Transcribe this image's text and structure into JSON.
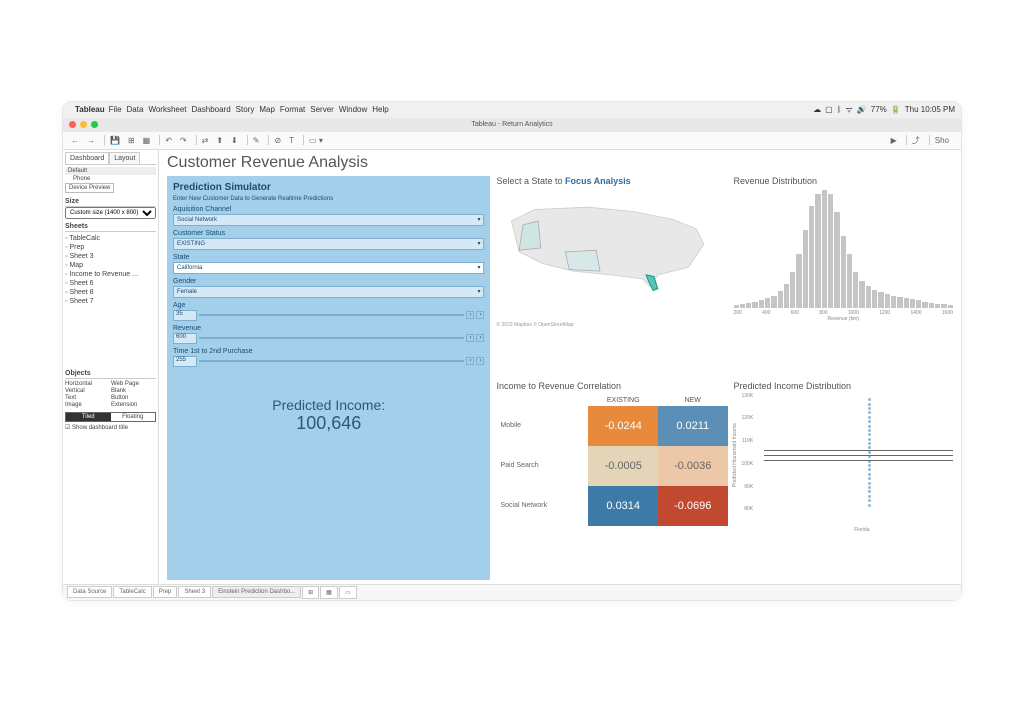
{
  "menubar": {
    "app": "Tableau",
    "menus": [
      "File",
      "Data",
      "Worksheet",
      "Dashboard",
      "Story",
      "Map",
      "Format",
      "Server",
      "Window",
      "Help"
    ],
    "battery": "77%",
    "time": "Thu 10:05 PM"
  },
  "titlebar": {
    "doc": "Tableau - Return Analytics"
  },
  "toolbar": {
    "show": "Sho"
  },
  "sidebar": {
    "tabs": {
      "dashboard": "Dashboard",
      "layout": "Layout"
    },
    "device": {
      "default": "Default",
      "phone": "Phone",
      "preview": "Device Preview"
    },
    "size": {
      "hdr": "Size",
      "value": "Custom size (1400 x 800)"
    },
    "sheets": {
      "hdr": "Sheets",
      "items": [
        "TableCalc",
        "Prep",
        "Sheet 3",
        "Map",
        "Income to Revenue ...",
        "Sheet 6",
        "Sheet 8",
        "Sheet 7"
      ]
    },
    "objects": {
      "hdr": "Objects",
      "items": [
        "Horizontal",
        "Web Page",
        "Vertical",
        "Blank",
        "Text",
        "Button",
        "Image",
        "Extension"
      ]
    },
    "toggle": {
      "tiled": "Tiled",
      "floating": "Floating"
    },
    "showtitle": "Show dashboard title"
  },
  "dashboard": {
    "title": "Customer Revenue Analysis",
    "map": {
      "title_a": "Select a State to ",
      "title_b": "Focus Analysis",
      "attribution": "© 2023 Mapbox © OpenStreetMap"
    },
    "hist": {
      "title": "Revenue Distribution",
      "xticks": [
        "200",
        "400",
        "600",
        "800",
        "1000",
        "1200",
        "1400",
        "1600"
      ],
      "xlabel": "Revenue (bin)"
    },
    "corr": {
      "title": "Income to Revenue Correlation",
      "cols": [
        "EXISTING",
        "NEW"
      ],
      "rows": [
        "Mobile",
        "Paid Search",
        "Social Network"
      ]
    },
    "scatter": {
      "title": "Predicted Income Distribution",
      "yticks": [
        "130K",
        "120K",
        "110K",
        "100K",
        "90K",
        "80K"
      ],
      "ylabel": "Predicted Household Income",
      "xlabel": "Florida"
    }
  },
  "predictor": {
    "title": "Prediction Simulator",
    "sub": "Enter New Customer Data to Generate Realtime Predictions",
    "channel": {
      "label": "Aquisition Channel",
      "value": "Social Network"
    },
    "status": {
      "label": "Customer Status",
      "value": "EXISTING"
    },
    "state": {
      "label": "State",
      "value": "California"
    },
    "gender": {
      "label": "Gender",
      "value": "Female"
    },
    "age": {
      "label": "Age",
      "value": "35"
    },
    "revenue": {
      "label": "Revenue",
      "value": "600"
    },
    "time": {
      "label": "Time 1st to 2nd Purchase",
      "value": "255"
    },
    "result": {
      "label": "Predicted Income:",
      "value": "100,646"
    }
  },
  "bottomtabs": {
    "datasource": "Data Source",
    "tabs": [
      "TableCalc",
      "Prep",
      "Sheet 3",
      "Einstein Prediction Dashbo..."
    ]
  },
  "chart_data": {
    "type": "heatmap",
    "title": "Income to Revenue Correlation",
    "rows": [
      "Mobile",
      "Paid Search",
      "Social Network"
    ],
    "columns": [
      "EXISTING",
      "NEW"
    ],
    "values": [
      [
        -0.0244,
        0.0211
      ],
      [
        -0.0005,
        -0.0036
      ],
      [
        0.0314,
        -0.0696
      ]
    ]
  }
}
